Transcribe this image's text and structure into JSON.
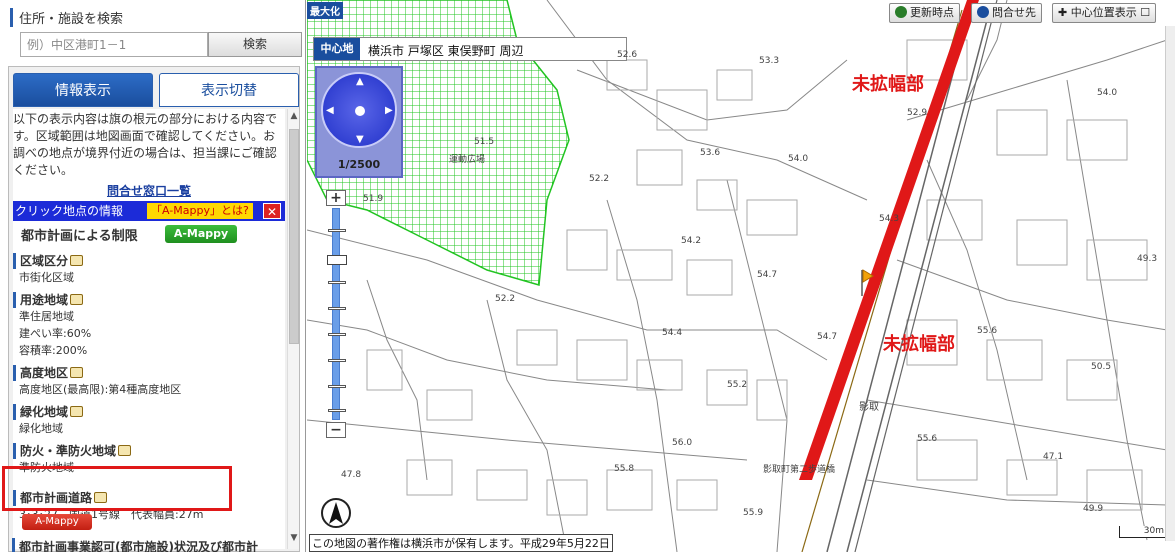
{
  "search": {
    "title": "住所・施設を検索",
    "placeholder": "例）中区港町1－1",
    "button": "検索"
  },
  "tabs": [
    {
      "label": "情報表示",
      "active": true
    },
    {
      "label": "表示切替",
      "active": false
    }
  ],
  "info": {
    "intro": "以下の表示内容は旗の根元の部分における内容です。区域範囲は地図画面で確認してください。お調べの地点が境界付近の場合は、担当課にご確認ください。",
    "contact_link": "問合せ窓口一覧",
    "click_title": "クリック地点の情報",
    "amappy_q": "「A-Mappy」とは?",
    "close": "✕",
    "restrict_title": "都市計画による制限",
    "amappy_btn": "A-Mappy",
    "sections": [
      {
        "head": "区域区分",
        "values": [
          "市街化区域"
        ]
      },
      {
        "head": "用途地域",
        "values": [
          "準住居地域",
          "建ぺい率:60%",
          "容積率:200%"
        ]
      },
      {
        "head": "高度地区",
        "values": [
          "高度地区(最高限):第4種高度地区"
        ]
      },
      {
        "head": "緑化地域",
        "values": [
          "緑化地域"
        ]
      },
      {
        "head": "防火・準防火地域",
        "values": [
          "準防火地域"
        ]
      },
      {
        "head": "都市計画道路",
        "values": [
          "3･3･27　国道1号線　代表幅員:27m"
        ]
      }
    ],
    "amappy_red": "A-Mappy",
    "bottom_head": "都市計画事業認可(都市施設)状況及び都市計"
  },
  "map": {
    "max_label": "最大化",
    "update_btn": "更新時点",
    "contact_btn": "問合せ先",
    "center_btn": "中心位置表示",
    "center_label": "中心地",
    "center_text": "横浜市 戸塚区 東俣野町 周辺",
    "scale": "1/2500",
    "red_label_1": "未拡幅部",
    "red_label_2": "未拡幅部",
    "place_1": "運動広場",
    "place_2": "影取",
    "place_3": "影取町第二歩道橋",
    "copyright": "この地図の著作権は横浜市が保有します。平成29年5月22日",
    "scale_bar": "30m",
    "elevations": [
      "52.6",
      "53.3",
      "53.6",
      "54.0",
      "51.5",
      "52.2",
      "51.9",
      "54.2",
      "54.3",
      "54.7",
      "52.2",
      "54.4",
      "54.7",
      "55.2",
      "56.0",
      "55.8",
      "55.9",
      "54.0",
      "52.9",
      "49.3",
      "55.6",
      "50.5",
      "55.6",
      "47.1",
      "47.8",
      "49.9"
    ]
  },
  "colors": {
    "accent": "#1a4e9e",
    "road": "#e01818",
    "grid": "#22c422"
  }
}
